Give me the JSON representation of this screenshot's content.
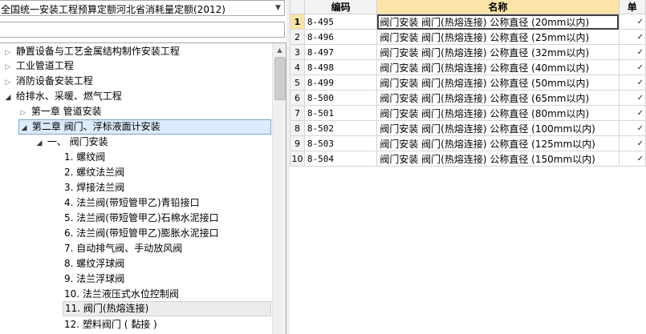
{
  "quota_selector": {
    "value": "全国统一安装工程预算定额河北省消耗量定额(2012)"
  },
  "filter": {
    "value": ""
  },
  "tree": [
    {
      "label": "静置设备与工艺金属结构制作安装工程",
      "toggle": "▷"
    },
    {
      "label": "工业管道工程",
      "toggle": "▷"
    },
    {
      "label": "消防设备安装工程",
      "toggle": "▷"
    },
    {
      "label": "给排水、采暖、燃气工程",
      "toggle": "◢"
    },
    {
      "label": "第一章 管道安装",
      "toggle": "▷"
    },
    {
      "label": "第二章 阀门、浮标液面计安装",
      "toggle": "◢"
    },
    {
      "label": "一、 阀门安装",
      "toggle": "◢"
    },
    {
      "label": "1. 螺纹阀",
      "toggle": ""
    },
    {
      "label": "2. 螺纹法兰阀",
      "toggle": ""
    },
    {
      "label": "3. 焊接法兰阀",
      "toggle": ""
    },
    {
      "label": "4. 法兰阀(带短管甲乙)青铅接口",
      "toggle": ""
    },
    {
      "label": "5. 法兰阀(带短管甲乙)石棉水泥接口",
      "toggle": ""
    },
    {
      "label": "6. 法兰阀(带短管甲乙)膨胀水泥接口",
      "toggle": ""
    },
    {
      "label": "7. 自动排气阀、手动放风阀",
      "toggle": ""
    },
    {
      "label": "8. 螺纹浮球阀",
      "toggle": ""
    },
    {
      "label": "9. 法兰浮球阀",
      "toggle": ""
    },
    {
      "label": "10. 法兰液压式水位控制阀",
      "toggle": ""
    },
    {
      "label": "11. 阀门(热熔连接)",
      "toggle": ""
    },
    {
      "label": "12. 塑料阀门 ( 黏接 )",
      "toggle": ""
    }
  ],
  "grid": {
    "headers": {
      "index": "",
      "code": "编码",
      "name": "名称",
      "unit": "单"
    },
    "rows": [
      {
        "idx": "1",
        "code": "8-495",
        "name": "阀门安装 阀门(热熔连接) 公称直径 (20mm以内)",
        "unit": "✓"
      },
      {
        "idx": "2",
        "code": "8-496",
        "name": "阀门安装 阀门(热熔连接) 公称直径 (25mm以内)",
        "unit": "✓"
      },
      {
        "idx": "3",
        "code": "8-497",
        "name": "阀门安装 阀门(热熔连接) 公称直径 (32mm以内)",
        "unit": "✓"
      },
      {
        "idx": "4",
        "code": "8-498",
        "name": "阀门安装 阀门(热熔连接) 公称直径 (40mm以内)",
        "unit": "✓"
      },
      {
        "idx": "5",
        "code": "8-499",
        "name": "阀门安装 阀门(热熔连接) 公称直径 (50mm以内)",
        "unit": "✓"
      },
      {
        "idx": "6",
        "code": "8-500",
        "name": "阀门安装 阀门(热熔连接) 公称直径 (65mm以内)",
        "unit": "✓"
      },
      {
        "idx": "7",
        "code": "8-501",
        "name": "阀门安装 阀门(热熔连接) 公称直径 (80mm以内)",
        "unit": "✓"
      },
      {
        "idx": "8",
        "code": "8-502",
        "name": "阀门安装 阀门(热熔连接) 公称直径 (100mm以内)",
        "unit": "✓"
      },
      {
        "idx": "9",
        "code": "8-503",
        "name": "阀门安装 阀门(热熔连接) 公称直径 (125mm以内)",
        "unit": "✓"
      },
      {
        "idx": "10",
        "code": "8-504",
        "name": "阀门安装 阀门(热熔连接) 公称直径 (150mm以内)",
        "unit": "✓"
      }
    ]
  },
  "colors": {
    "header_highlight": "#fce4a8",
    "selection": "#ececec"
  }
}
